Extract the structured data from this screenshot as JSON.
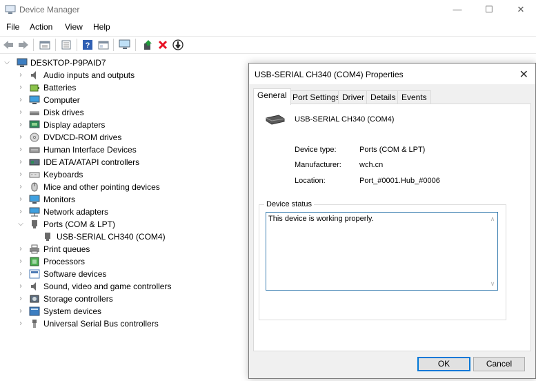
{
  "window": {
    "title": "Device Manager",
    "controls": [
      "—",
      "☐",
      "✕"
    ]
  },
  "menu": [
    "File",
    "Action",
    "View",
    "Help"
  ],
  "toolbar": {
    "icons": [
      "back-arrow-icon",
      "forward-arrow-icon",
      "properties-icon",
      "show-hidden-icon",
      "help-icon",
      "action-view-icon",
      "scan-hardware-icon",
      "update-driver-icon",
      "uninstall-icon",
      "disable-device-icon"
    ],
    "uninstall_color": "#e81123"
  },
  "tree": {
    "root": "DESKTOP-P9PAID7",
    "items": [
      {
        "label": "Audio inputs and outputs",
        "icon": "speaker-icon"
      },
      {
        "label": "Batteries",
        "icon": "battery-icon"
      },
      {
        "label": "Computer",
        "icon": "monitor-icon"
      },
      {
        "label": "Disk drives",
        "icon": "disk-icon"
      },
      {
        "label": "Display adapters",
        "icon": "display-adapter-icon"
      },
      {
        "label": "DVD/CD-ROM drives",
        "icon": "dvd-icon"
      },
      {
        "label": "Human Interface Devices",
        "icon": "hid-icon"
      },
      {
        "label": "IDE ATA/ATAPI controllers",
        "icon": "ide-icon"
      },
      {
        "label": "Keyboards",
        "icon": "keyboard-icon"
      },
      {
        "label": "Mice and other pointing devices",
        "icon": "mouse-icon"
      },
      {
        "label": "Monitors",
        "icon": "monitor-icon"
      },
      {
        "label": "Network adapters",
        "icon": "network-icon"
      },
      {
        "label": "Ports (COM & LPT)",
        "icon": "port-icon",
        "expanded": true
      },
      {
        "label": "USB-SERIAL CH340 (COM4)",
        "icon": "port-icon",
        "child": true
      },
      {
        "label": "Print queues",
        "icon": "printer-icon"
      },
      {
        "label": "Processors",
        "icon": "processor-icon"
      },
      {
        "label": "Software devices",
        "icon": "software-icon"
      },
      {
        "label": "Sound, video and game controllers",
        "icon": "speaker-icon"
      },
      {
        "label": "Storage controllers",
        "icon": "storage-icon"
      },
      {
        "label": "System devices",
        "icon": "system-icon"
      },
      {
        "label": "Universal Serial Bus controllers",
        "icon": "usb-icon"
      }
    ]
  },
  "dialog": {
    "title": "USB-SERIAL CH340 (COM4) Properties",
    "close": "✕",
    "tabs": [
      "General",
      "Port Settings",
      "Driver",
      "Details",
      "Events"
    ],
    "active_tab": "General",
    "device_name": "USB-SERIAL CH340 (COM4)",
    "properties": [
      {
        "label": "Device type:",
        "value": "Ports (COM & LPT)"
      },
      {
        "label": "Manufacturer:",
        "value": "wch.cn"
      },
      {
        "label": "Location:",
        "value": "Port_#0001.Hub_#0006"
      }
    ],
    "status_title": "Device status",
    "status_text": "This device is working properly.",
    "ok_label": "OK",
    "cancel_label": "Cancel",
    "accent": "#0078d7"
  }
}
